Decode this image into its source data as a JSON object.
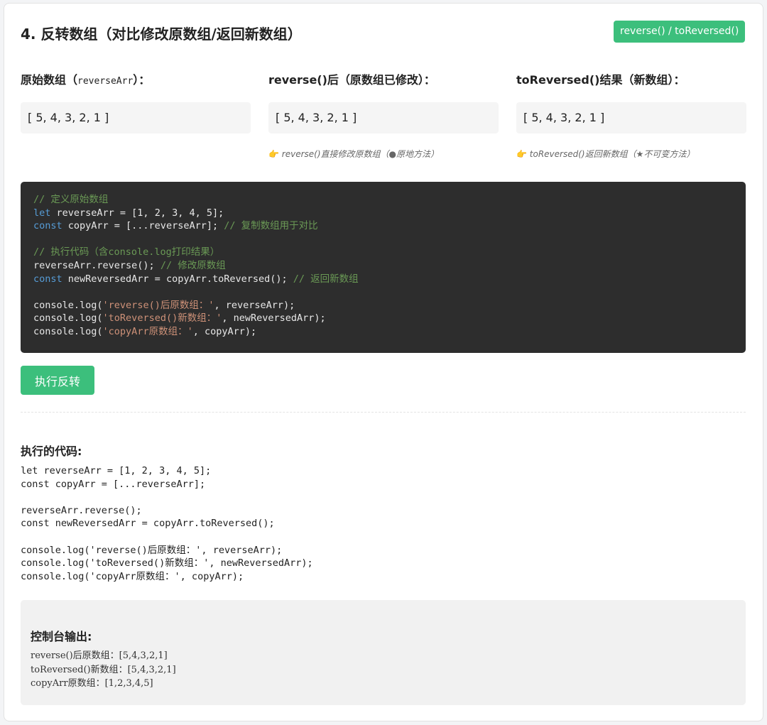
{
  "header": {
    "title": "4. 反转数组（对比修改原数组/返回新数组）",
    "badge": "reverse() / toReversed()"
  },
  "columns": [
    {
      "label_prefix": "原始数组（",
      "label_mono": "reverseArr",
      "label_suffix": "）：",
      "value": "[ 5, 4, 3, 2, 1 ]",
      "note": ""
    },
    {
      "label": "reverse()后（原数组已修改）：",
      "value": "[ 5, 4, 3, 2, 1 ]",
      "note_icon": "👉",
      "note": "reverse()直接修改原数组（●原地方法）"
    },
    {
      "label": "toReversed()结果（新数组）：",
      "value": "[ 5, 4, 3, 2, 1 ]",
      "note_icon": "👉",
      "note": "toReversed()返回新数组（★不可变方法）"
    }
  ],
  "code_editor": {
    "c1": "// 定义原始数组",
    "l2_kw": "let",
    "l2_rest": " reverseArr = [1, 2, 3, 4, 5];",
    "l3_kw": "const",
    "l3_rest": " copyArr = [...reverseArr]; ",
    "l3_comment": "// 复制数组用于对比",
    "c5": "// 执行代码（含console.log打印结果）",
    "l6_code": "reverseArr.reverse(); ",
    "l6_comment": "// 修改原数组",
    "l7_kw": "const",
    "l7_rest": " newReversedArr = copyArr.toReversed(); ",
    "l7_comment": "// 返回新数组",
    "l9_a": "console.log(",
    "l9_str": "'reverse()后原数组：'",
    "l9_b": ", reverseArr);",
    "l10_a": "console.log(",
    "l10_str": "'toReversed()新数组：'",
    "l10_b": ", newReversedArr);",
    "l11_a": "console.log(",
    "l11_str": "'copyArr原数组：'",
    "l11_b": ", copyArr);"
  },
  "run_button": "执行反转",
  "executed": {
    "title": "执行的代码:",
    "lines": [
      "let reverseArr = [1, 2, 3, 4, 5];",
      "const copyArr = [...reverseArr];",
      "",
      "reverseArr.reverse();",
      "const newReversedArr = copyArr.toReversed();",
      "",
      "console.log('reverse()后原数组：', reverseArr);",
      "console.log('toReversed()新数组：', newReversedArr);",
      "console.log('copyArr原数组：', copyArr);"
    ]
  },
  "console": {
    "title": "控制台输出:",
    "lines": [
      "reverse()后原数组：[5,4,3,2,1]",
      "toReversed()新数组：[5,4,3,2,1]",
      "copyArr原数组：[1,2,3,4,5]"
    ]
  },
  "colors": {
    "accent": "#3cbf7c",
    "code_bg": "#2d2d2d",
    "comment": "#6a9955",
    "keyword": "#569cd6",
    "string": "#ce9178"
  }
}
